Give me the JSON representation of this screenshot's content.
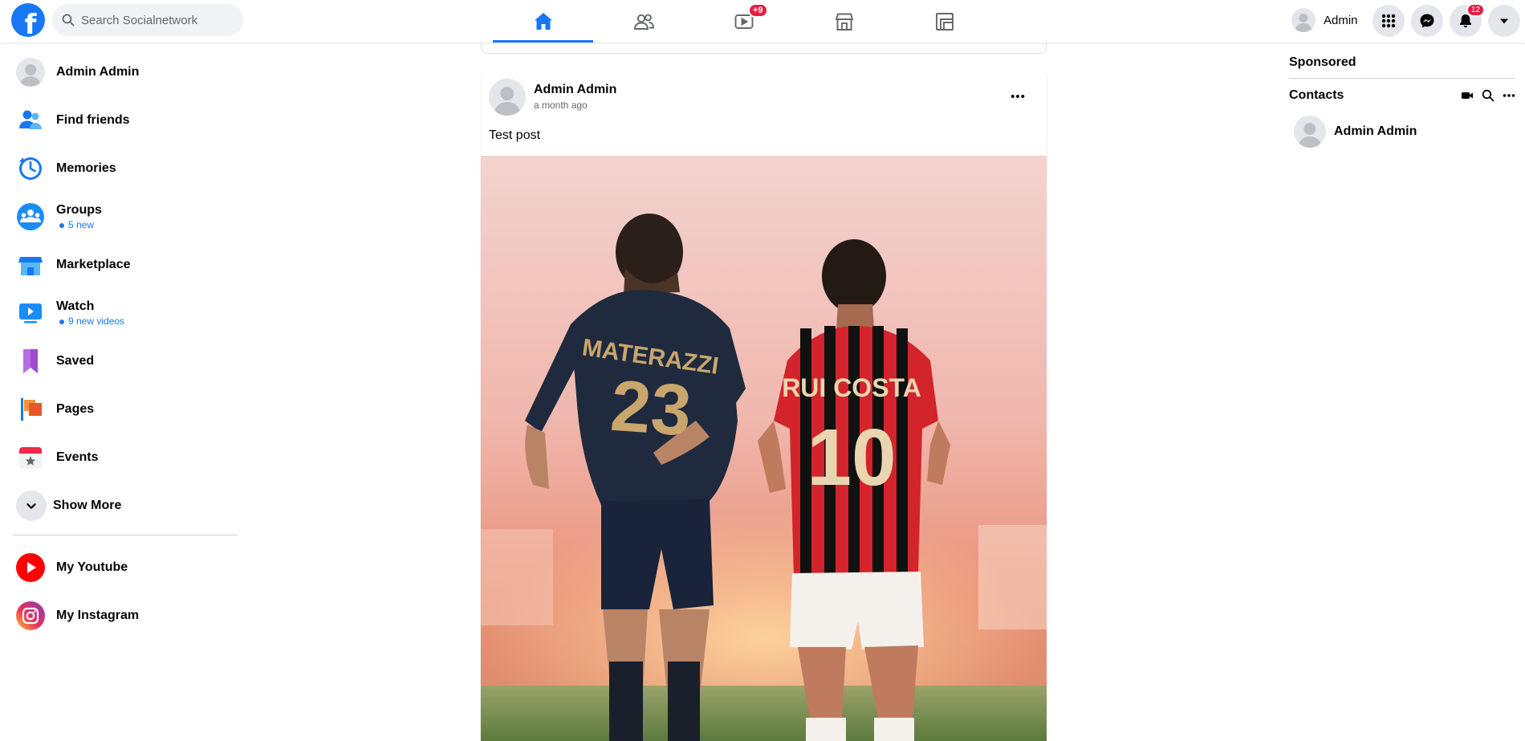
{
  "header": {
    "logo_letter": "f",
    "search": {
      "placeholder": "Search Socialnetwork"
    },
    "nav_tabs": [
      {
        "name": "home",
        "icon": "home-icon",
        "active": true
      },
      {
        "name": "friends",
        "icon": "friends-icon",
        "active": false
      },
      {
        "name": "watch",
        "icon": "watch-icon",
        "active": false,
        "badge": "+9"
      },
      {
        "name": "marketplace",
        "icon": "marketplace-icon",
        "active": false
      },
      {
        "name": "groups",
        "icon": "groups-icon",
        "active": false
      }
    ],
    "profile_name": "Admin",
    "notifications_badge": "12",
    "accent_color": "#1877f2",
    "badge_color": "#e41e3f"
  },
  "left_sidebar": {
    "items": [
      {
        "label": "Admin Admin",
        "icon": "avatar"
      },
      {
        "label": "Find friends",
        "icon": "find-friends-icon"
      },
      {
        "label": "Memories",
        "icon": "memories-icon"
      },
      {
        "label": "Groups",
        "icon": "groups-icon",
        "sub": "5 new"
      },
      {
        "label": "Marketplace",
        "icon": "marketplace-icon"
      },
      {
        "label": "Watch",
        "icon": "watch-icon",
        "sub": "9 new videos"
      },
      {
        "label": "Saved",
        "icon": "saved-icon"
      },
      {
        "label": "Pages",
        "icon": "pages-icon"
      },
      {
        "label": "Events",
        "icon": "events-icon"
      }
    ],
    "show_more": "Show More",
    "shortcuts": [
      {
        "label": "My Youtube",
        "icon": "youtube-icon"
      },
      {
        "label": "My Instagram",
        "icon": "instagram-icon"
      }
    ]
  },
  "post": {
    "author": "Admin Admin",
    "time": "a month ago",
    "text": "Test post",
    "image": {
      "players": [
        {
          "name": "MATERAZZI",
          "number": "23"
        },
        {
          "name": "RUI COSTA",
          "number": "10"
        }
      ]
    }
  },
  "right_sidebar": {
    "sponsored": "Sponsored",
    "contacts": "Contacts",
    "contact_list": [
      {
        "name": "Admin Admin"
      }
    ]
  }
}
